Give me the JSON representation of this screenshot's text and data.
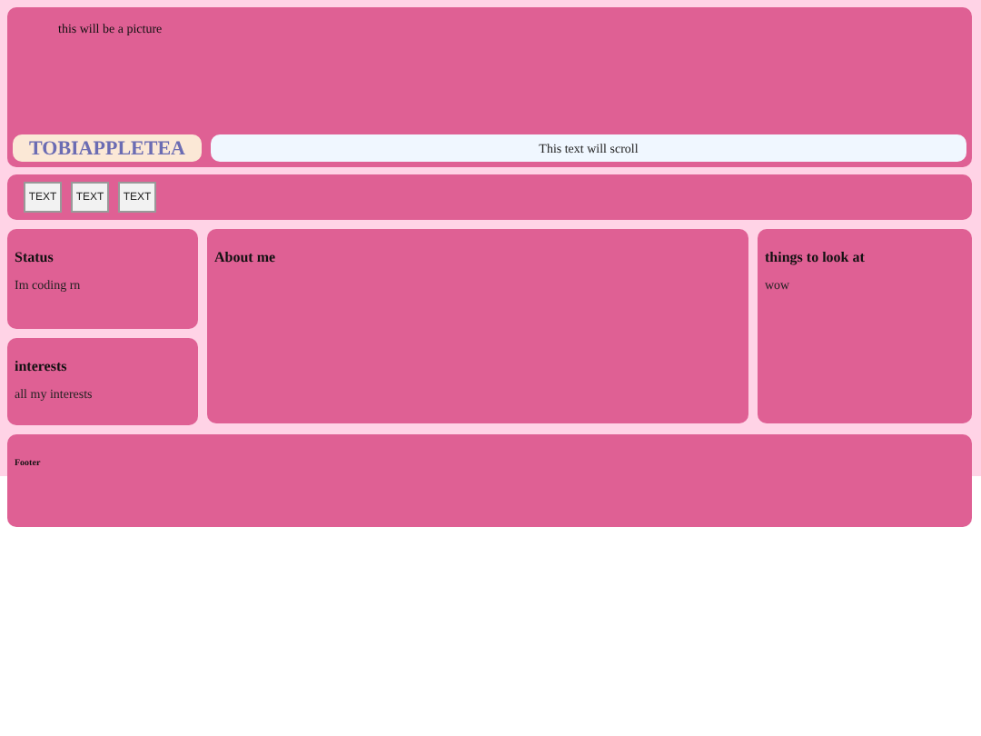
{
  "header": {
    "picture_text": "this will be a picture",
    "name": "TOBIAPPLETEA",
    "marquee": "This text will scroll"
  },
  "nav": {
    "buttons": [
      "TEXT",
      "TEXT",
      "TEXT"
    ]
  },
  "left": [
    {
      "title": "Status",
      "text": "Im coding rn"
    },
    {
      "title": "interests",
      "text": "all my interests"
    }
  ],
  "main": {
    "title": "About me"
  },
  "right": {
    "title": "things to look at",
    "text": "wow"
  },
  "footer": {
    "title": "Footer"
  }
}
